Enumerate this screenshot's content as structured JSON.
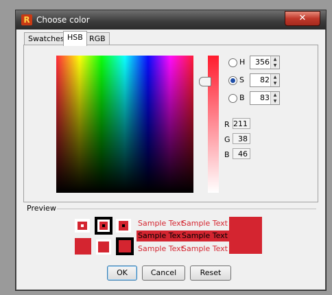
{
  "window": {
    "title": "Choose color"
  },
  "tabs": [
    {
      "label": "Swatches",
      "active": false
    },
    {
      "label": "HSB",
      "active": true
    },
    {
      "label": "RGB",
      "active": false
    }
  ],
  "hsb": {
    "h": {
      "label": "H",
      "value": "356",
      "selected": false
    },
    "s": {
      "label": "S",
      "value": "82",
      "selected": true
    },
    "b": {
      "label": "B",
      "value": "83",
      "selected": false
    }
  },
  "rgb": {
    "r": {
      "label": "R",
      "value": "211"
    },
    "g": {
      "label": "G",
      "value": "38"
    },
    "b": {
      "label": "B",
      "value": "46"
    }
  },
  "preview": {
    "label": "Preview",
    "sample_text": "Sample Text",
    "color": "#d42530"
  },
  "buttons": {
    "ok": "OK",
    "cancel": "Cancel",
    "reset": "Reset"
  },
  "icons": {
    "app": "app-logo-icon",
    "close": "close-icon"
  }
}
